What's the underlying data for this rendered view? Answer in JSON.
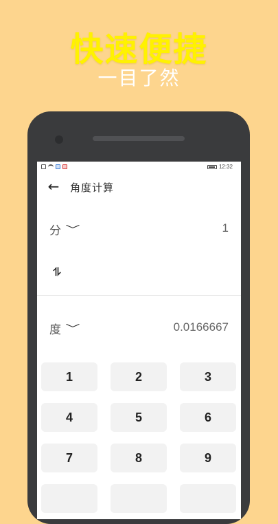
{
  "promo": {
    "headline": "快速便捷",
    "subheadline": "一目了然"
  },
  "status_bar": {
    "time": "12:32",
    "battery_level": 0.9
  },
  "appbar": {
    "back_icon": "←",
    "title": "角度计算"
  },
  "converter": {
    "from_unit": "分",
    "from_value": "1",
    "swap_icon": "⥮",
    "to_unit": "度",
    "to_value": "0.0166667",
    "dropdown_icon": "﹀"
  },
  "keypad": {
    "keys": [
      "1",
      "2",
      "3",
      "4",
      "5",
      "6",
      "7",
      "8",
      "9"
    ]
  },
  "colors": {
    "background": "#FDD58E",
    "headline": "#FFF200",
    "subheadline": "#FFFFFF",
    "phone_frame": "#3A3B3D",
    "key_background": "#F2F2F2"
  }
}
